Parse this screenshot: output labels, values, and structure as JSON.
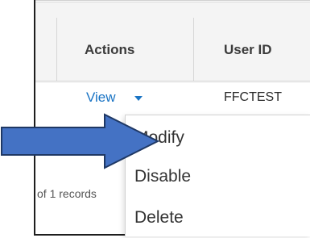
{
  "table": {
    "headers": {
      "actions": "Actions",
      "user_id": "User ID"
    },
    "rows": [
      {
        "action_link": "View",
        "user_id": "FFCTEST"
      }
    ],
    "footer_text": "of 1 records"
  },
  "actions_menu": {
    "items": [
      "Modify",
      "Disable",
      "Delete"
    ]
  },
  "annotation": {
    "arrow_color": "#4472c4",
    "arrow_outline": "#1f3864",
    "points_to": "Modify"
  },
  "colors": {
    "link": "#1a74c4",
    "header_bg": "#f4f4f4"
  }
}
